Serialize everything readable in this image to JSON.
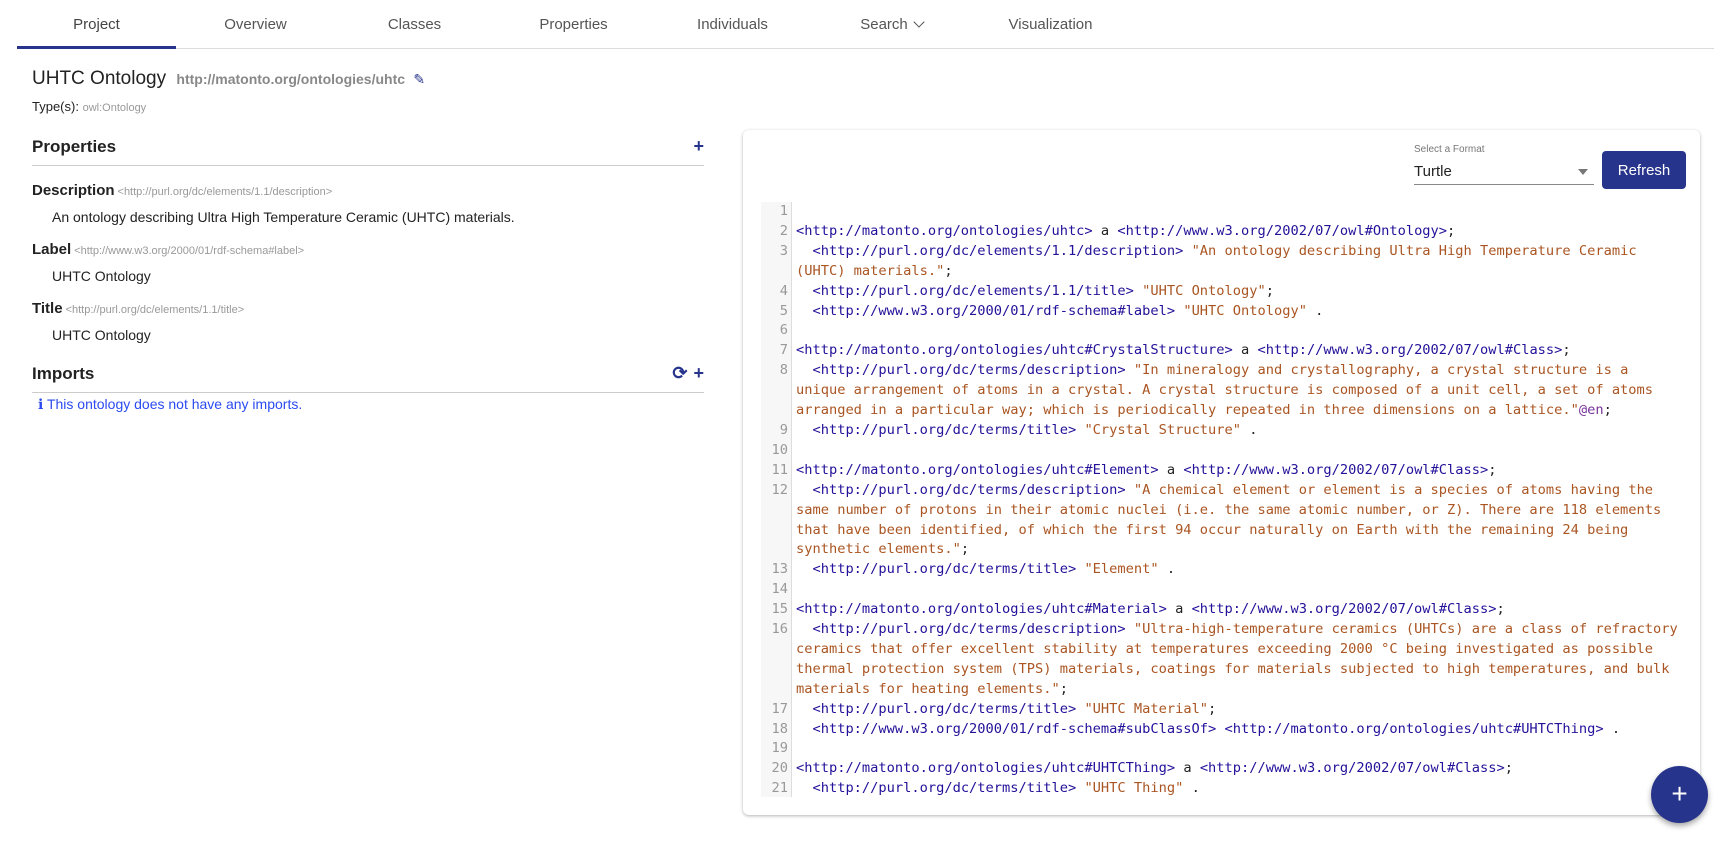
{
  "tabs": [
    {
      "label": "Project"
    },
    {
      "label": "Overview"
    },
    {
      "label": "Classes"
    },
    {
      "label": "Properties"
    },
    {
      "label": "Individuals"
    },
    {
      "label": "Search"
    },
    {
      "label": "Visualization"
    }
  ],
  "ontology": {
    "title": "UHTC Ontology",
    "iri": "http://matonto.org/ontologies/uhtc",
    "types_label": "Type(s):",
    "types": "owl:Ontology"
  },
  "properties": {
    "header": "Properties",
    "items": [
      {
        "name": "Description",
        "iri": "<http://purl.org/dc/elements/1.1/description>",
        "value": "An ontology describing Ultra High Temperature Ceramic (UHTC) materials."
      },
      {
        "name": "Label",
        "iri": "<http://www.w3.org/2000/01/rdf-schema#label>",
        "value": "UHTC Ontology"
      },
      {
        "name": "Title",
        "iri": "<http://purl.org/dc/elements/1.1/title>",
        "value": "UHTC Ontology"
      }
    ]
  },
  "imports": {
    "header": "Imports",
    "empty_message": "This ontology does not have any imports."
  },
  "preview": {
    "format_label": "Select a Format",
    "format": "Turtle",
    "refresh_label": "Refresh"
  },
  "colors": {
    "accent": "#27348b",
    "uri": "#221199",
    "string": "#aa5522",
    "info": "#2b4bf0"
  },
  "code": [
    {
      "n": "1",
      "tokens": []
    },
    {
      "n": "2",
      "tokens": [
        [
          "uri",
          "<http://matonto.org/ontologies/uhtc>"
        ],
        [
          "pl",
          " a "
        ],
        [
          "uri",
          "<http://www.w3.org/2002/07/owl#Ontology>"
        ],
        [
          "pl",
          ";"
        ]
      ]
    },
    {
      "n": "3",
      "tokens": [
        [
          "pl",
          "  "
        ],
        [
          "uri",
          "<http://purl.org/dc/elements/1.1/description>"
        ],
        [
          "pl",
          " "
        ],
        [
          "str",
          "\"An ontology describing Ultra High Temperature Ceramic (UHTC) materials.\""
        ],
        [
          "pl",
          ";"
        ]
      ]
    },
    {
      "n": "4",
      "tokens": [
        [
          "pl",
          "  "
        ],
        [
          "uri",
          "<http://purl.org/dc/elements/1.1/title>"
        ],
        [
          "pl",
          " "
        ],
        [
          "str",
          "\"UHTC Ontology\""
        ],
        [
          "pl",
          ";"
        ]
      ]
    },
    {
      "n": "5",
      "tokens": [
        [
          "pl",
          "  "
        ],
        [
          "uri",
          "<http://www.w3.org/2000/01/rdf-schema#label>"
        ],
        [
          "pl",
          " "
        ],
        [
          "str",
          "\"UHTC Ontology\""
        ],
        [
          "pl",
          " ."
        ]
      ]
    },
    {
      "n": "6",
      "tokens": []
    },
    {
      "n": "7",
      "tokens": [
        [
          "uri",
          "<http://matonto.org/ontologies/uhtc#CrystalStructure>"
        ],
        [
          "pl",
          " a "
        ],
        [
          "uri",
          "<http://www.w3.org/2002/07/owl#Class>"
        ],
        [
          "pl",
          ";"
        ]
      ]
    },
    {
      "n": "8",
      "tokens": [
        [
          "pl",
          "  "
        ],
        [
          "uri",
          "<http://purl.org/dc/terms/description>"
        ],
        [
          "pl",
          " "
        ],
        [
          "str",
          "\"In mineralogy and crystallography, a crystal structure is a unique arrangement of atoms in a crystal. A crystal structure is composed of a unit cell, a set of atoms arranged in a particular way; which is periodically repeated in three dimensions on a lattice.\""
        ],
        [
          "lang",
          "@en"
        ],
        [
          "pl",
          ";"
        ]
      ]
    },
    {
      "n": "9",
      "tokens": [
        [
          "pl",
          "  "
        ],
        [
          "uri",
          "<http://purl.org/dc/terms/title>"
        ],
        [
          "pl",
          " "
        ],
        [
          "str",
          "\"Crystal Structure\""
        ],
        [
          "pl",
          " ."
        ]
      ]
    },
    {
      "n": "10",
      "tokens": []
    },
    {
      "n": "11",
      "tokens": [
        [
          "uri",
          "<http://matonto.org/ontologies/uhtc#Element>"
        ],
        [
          "pl",
          " a "
        ],
        [
          "uri",
          "<http://www.w3.org/2002/07/owl#Class>"
        ],
        [
          "pl",
          ";"
        ]
      ]
    },
    {
      "n": "12",
      "tokens": [
        [
          "pl",
          "  "
        ],
        [
          "uri",
          "<http://purl.org/dc/terms/description>"
        ],
        [
          "pl",
          " "
        ],
        [
          "str",
          "\"A chemical element or element is a species of atoms having the same number of protons in their atomic nuclei (i.e. the same atomic number, or Z). There are 118 elements that have been identified, of which the first 94 occur naturally on Earth with the remaining 24 being synthetic elements.\""
        ],
        [
          "pl",
          ";"
        ]
      ]
    },
    {
      "n": "13",
      "tokens": [
        [
          "pl",
          "  "
        ],
        [
          "uri",
          "<http://purl.org/dc/terms/title>"
        ],
        [
          "pl",
          " "
        ],
        [
          "str",
          "\"Element\""
        ],
        [
          "pl",
          " ."
        ]
      ]
    },
    {
      "n": "14",
      "tokens": []
    },
    {
      "n": "15",
      "tokens": [
        [
          "uri",
          "<http://matonto.org/ontologies/uhtc#Material>"
        ],
        [
          "pl",
          " a "
        ],
        [
          "uri",
          "<http://www.w3.org/2002/07/owl#Class>"
        ],
        [
          "pl",
          ";"
        ]
      ]
    },
    {
      "n": "16",
      "tokens": [
        [
          "pl",
          "  "
        ],
        [
          "uri",
          "<http://purl.org/dc/terms/description>"
        ],
        [
          "pl",
          " "
        ],
        [
          "str",
          "\"Ultra-high-temperature ceramics (UHTCs) are a class of refractory ceramics that offer excellent stability at temperatures exceeding 2000 °C being investigated as possible thermal protection system (TPS) materials, coatings for materials subjected to high temperatures, and bulk materials for heating elements.\""
        ],
        [
          "pl",
          ";"
        ]
      ]
    },
    {
      "n": "17",
      "tokens": [
        [
          "pl",
          "  "
        ],
        [
          "uri",
          "<http://purl.org/dc/terms/title>"
        ],
        [
          "pl",
          " "
        ],
        [
          "str",
          "\"UHTC Material\""
        ],
        [
          "pl",
          ";"
        ]
      ]
    },
    {
      "n": "18",
      "tokens": [
        [
          "pl",
          "  "
        ],
        [
          "uri",
          "<http://www.w3.org/2000/01/rdf-schema#subClassOf>"
        ],
        [
          "pl",
          " "
        ],
        [
          "uri",
          "<http://matonto.org/ontologies/uhtc#UHTCThing>"
        ],
        [
          "pl",
          " ."
        ]
      ]
    },
    {
      "n": "19",
      "tokens": []
    },
    {
      "n": "20",
      "tokens": [
        [
          "uri",
          "<http://matonto.org/ontologies/uhtc#UHTCThing>"
        ],
        [
          "pl",
          " a "
        ],
        [
          "uri",
          "<http://www.w3.org/2002/07/owl#Class>"
        ],
        [
          "pl",
          ";"
        ]
      ]
    },
    {
      "n": "21",
      "tokens": [
        [
          "pl",
          "  "
        ],
        [
          "uri",
          "<http://purl.org/dc/terms/title>"
        ],
        [
          "pl",
          " "
        ],
        [
          "str",
          "\"UHTC Thing\""
        ],
        [
          "pl",
          " ."
        ]
      ]
    }
  ],
  "fab": {
    "icon": "plus-icon",
    "label": "+"
  }
}
